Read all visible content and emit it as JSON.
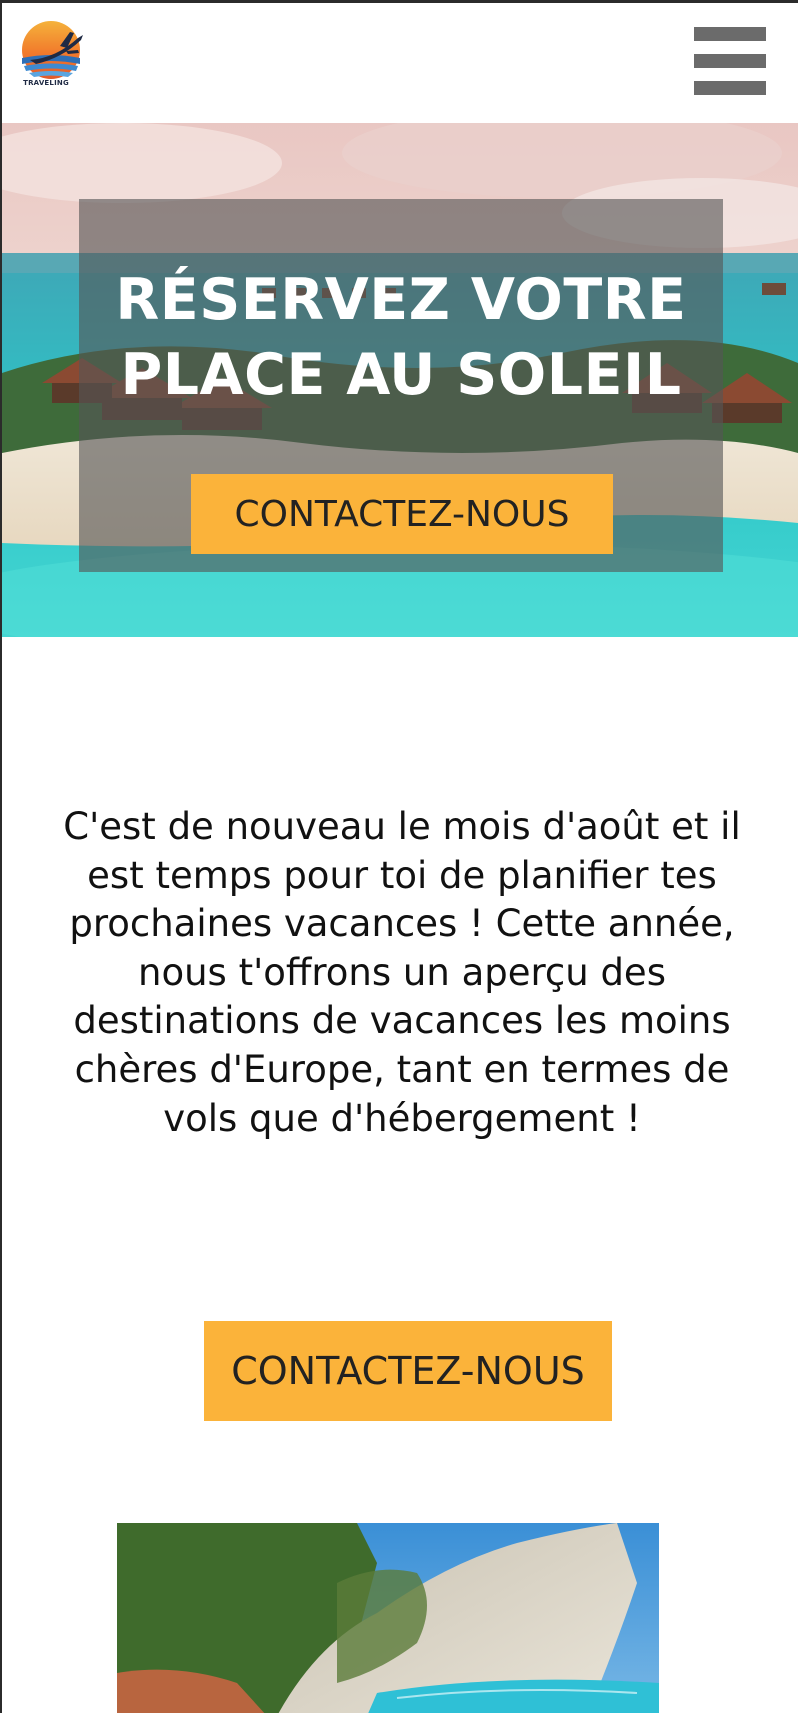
{
  "header": {
    "logo_text": "TRAVELING"
  },
  "hero": {
    "title_line1": "RÉSERVEZ VOTRE",
    "title_line2": "PLACE AU SOLEIL",
    "button_label": "CONTACTEZ-NOUS"
  },
  "intro": {
    "text": "C'est de nouveau le mois d'août et il est temps pour toi de planifier tes prochaines vacances ! Cette année, nous t'offrons un aperçu des destinations de vacances les moins chères d'Europe, tant en termes de vols que d'hébergement !",
    "button_label": "CONTACTEZ-NOUS"
  },
  "colors": {
    "accent": "#fbb33a",
    "menu_icon": "#6b6b6b",
    "overlay": "#555555"
  },
  "icons": {
    "menu": "hamburger-menu-icon",
    "logo": "airplane-sunset-logo"
  }
}
